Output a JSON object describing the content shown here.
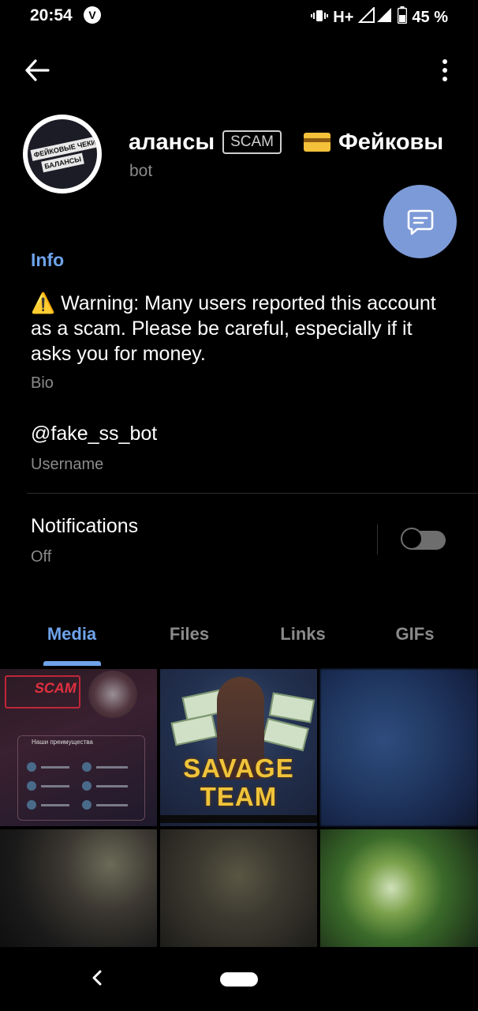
{
  "status_bar": {
    "time": "20:54",
    "vpn_glyph": "V",
    "network": "H+",
    "battery": "45 %",
    "icons": [
      "vibrate-icon",
      "signal-icon",
      "battery-icon"
    ]
  },
  "top_bar": {
    "back_icon": "arrow-left-icon",
    "menu_icon": "more-vertical-icon"
  },
  "profile": {
    "avatar_text_1": "ФЕЙКОВЫЕ ЧЕКИ",
    "avatar_text_2": "БАЛАНСЫ",
    "name": "алансы",
    "scam_badge": "SCAM",
    "name_secondary": "Фейковы",
    "subtitle": "bot"
  },
  "fab": {
    "icon": "message-icon",
    "color": "#7d9ad8"
  },
  "info": {
    "section_title": "Info",
    "bio": "⚠️ Warning: Many users reported this account as a scam. Please be careful, especially if it asks you for money.",
    "bio_label": "Bio",
    "username": "@fake_ss_bot",
    "username_label": "Username",
    "notifications_title": "Notifications",
    "notifications_status": "Off"
  },
  "tabs": [
    {
      "label": "Media",
      "active": true
    },
    {
      "label": "Files",
      "active": false
    },
    {
      "label": "Links",
      "active": false
    },
    {
      "label": "GIFs",
      "active": false
    }
  ],
  "media": {
    "thumb1": {
      "word": "SCAM",
      "panel_title": "Наши преимущества"
    },
    "thumb2": {
      "line1": "SAVAGE",
      "line2": "TEAM"
    }
  },
  "nav_bar": {
    "back_icon": "nav-back-icon",
    "home_icon": "home-pill-icon"
  },
  "colors": {
    "accent": "#6ea3ea",
    "background": "#000000",
    "secondary_text": "#8a8a8a"
  }
}
